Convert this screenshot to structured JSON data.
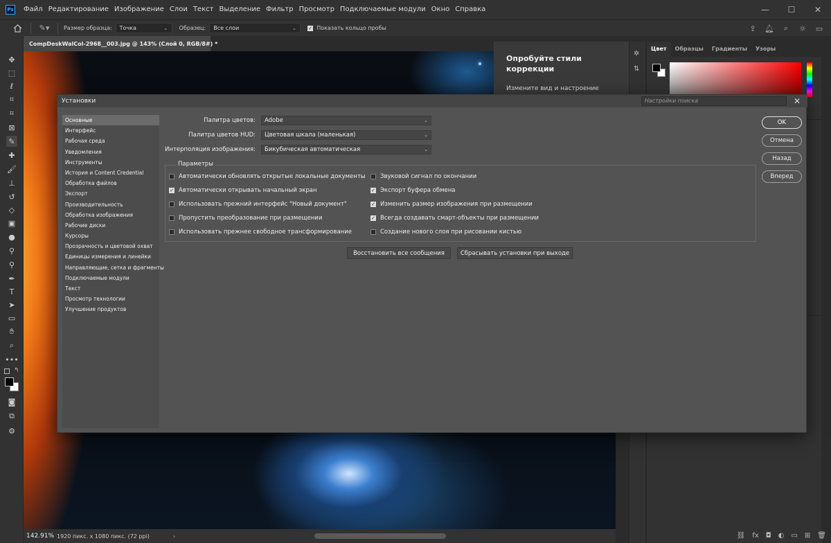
{
  "menubar": {
    "logo": "Ps",
    "items": [
      "Файл",
      "Редактирование",
      "Изображение",
      "Слои",
      "Текст",
      "Выделение",
      "Фильтр",
      "Просмотр",
      "Подключаемые модули",
      "Окно",
      "Справка"
    ]
  },
  "options_bar": {
    "sample_size_label": "Размер образца:",
    "sample_size_value": "Точка",
    "sample_label": "Образец:",
    "sample_value": "Все слои",
    "show_ring_label": "Показать кольцо пробы",
    "show_ring_checked": true
  },
  "document": {
    "tab_title": "CompDeskWalCol-2968__003.jpg @ 143% (Слой 0, RGB/8#) *",
    "zoom": "142.91%",
    "info": "1920 пикс. x 1080 пикс. (72 ppi)"
  },
  "learn_panel": {
    "title": "Опробуйте стили коррекции",
    "subtitle": "Измените вид и настроение"
  },
  "color_panel": {
    "tabs": [
      "Цвет",
      "Образцы",
      "Градиенты",
      "Узоры"
    ],
    "active_tab": "Цвет"
  },
  "dialog": {
    "title": "Установки",
    "search_placeholder": "Настройки поиска",
    "nav": [
      "Основные",
      "Интерфейс",
      "Рабочая среда",
      "Уведомления",
      "Инструменты",
      "История и Content Credential",
      "Обработка файлов",
      "Экспорт",
      "Производительность",
      "Обработка изображения",
      "Рабочие диски",
      "Курсоры",
      "Прозрачность и цветовой охват",
      "Единицы измерения и линейки",
      "Направляющие, сетка и фрагменты",
      "Подключаемые модули",
      "Текст",
      "Просмотр технологии",
      "Улучшение продуктов"
    ],
    "selected_nav": "Основные",
    "fields": {
      "color_picker_label": "Палитра цветов:",
      "color_picker_value": "Adobe",
      "hud_picker_label": "Палитра цветов HUD:",
      "hud_picker_value": "Цветовая шкала (маленькая)",
      "interpolation_label": "Интерполяция изображения:",
      "interpolation_value": "Бикубическая автоматическая"
    },
    "params_legend": "Параметры",
    "options_left": [
      {
        "label": "Автоматически обновлять открытые локальные документы",
        "checked": false
      },
      {
        "label": "Автоматически открывать начальный экран",
        "checked": true
      },
      {
        "label": "Использовать прежний интерфейс \"Новый документ\"",
        "checked": false
      },
      {
        "label": "Пропустить преобразование при размещении",
        "checked": false
      },
      {
        "label": "Использовать прежнее свободное трансформирование",
        "checked": false
      }
    ],
    "options_right": [
      {
        "label": "Звуковой сигнал по окончании",
        "checked": false
      },
      {
        "label": "Экспорт буфера обмена",
        "checked": true
      },
      {
        "label": "Изменить размер изображения при размещении",
        "checked": true
      },
      {
        "label": "Всегда создавать смарт-объекты при размещении",
        "checked": true
      },
      {
        "label": "Создание нового слоя при рисовании кистью",
        "checked": false
      }
    ],
    "reset_messages_button": "Восстановить все сообщения",
    "reset_on_quit_button": "Сбрасывать установки при выходе",
    "ok_button": "OK",
    "cancel_button": "Отмена",
    "prev_button": "Назад",
    "next_button": "Вперед"
  }
}
